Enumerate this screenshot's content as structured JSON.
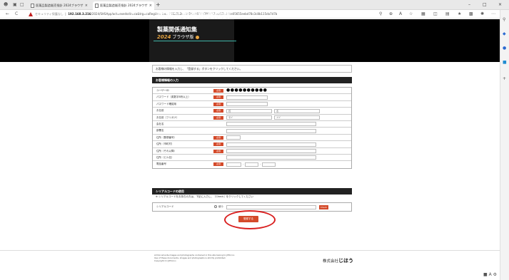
{
  "browser": {
    "tabs": [
      {
        "title": "医薬品製造販売指針 2024ブラウザ",
        "active": false
      },
      {
        "title": "医薬品製造販売指針 2024ブラウザ",
        "active": true
      }
    ],
    "new_tab": "+",
    "win_min": "–",
    "win_max": "□",
    "win_close": "×",
    "back": "←",
    "refresh": "C",
    "security_text": "セキュリティ保護なし",
    "url_host": "192.168.3.216",
    "url_path": "/2024/SHSApp/act=exedsdir=ca&trg=caRegUserdoc=74128b2883d555fb034c3ff0217?a017e2dce05655eebd78c3c8b115da7d7b",
    "icons": [
      "search-icon",
      "zoom-icon",
      "read-aloud-icon",
      "favorite-icon",
      "extension-icon",
      "split-icon",
      "collections-icon",
      "profile-icon",
      "more-icon"
    ]
  },
  "header": {
    "title": "医薬品製造販売指針",
    "subtitle": "製薬関係通知集",
    "year": "2024",
    "edition": "ブラウザ版"
  },
  "notice": "お客様の情報を入力し、「登録する」ボタンをクリックしてください。",
  "form": {
    "heading": "お客様情報の入力",
    "required_label": "必須",
    "rows": [
      {
        "label": "ユーザーID",
        "required": true,
        "value": "●●●●●●●●●●"
      },
      {
        "label": "パスワード（英数字8桁以上）",
        "required": true
      },
      {
        "label": "パスワード確認用",
        "required": true
      },
      {
        "label": "お名前",
        "required": true,
        "ph1": "姓",
        "ph2": "名"
      },
      {
        "label": "お名前（フリガナ）",
        "required": true,
        "ph1": "セイ",
        "ph2": "メイ"
      },
      {
        "label": "会社名",
        "required": false
      },
      {
        "label": "部署名",
        "required": false
      },
      {
        "label": "住所（郵便番号）",
        "required": true
      },
      {
        "label": "住所（市町村）",
        "required": true
      },
      {
        "label": "住所（それ以降）",
        "required": true
      },
      {
        "label": "住所（ビル名）",
        "required": false
      },
      {
        "label": "電話番号",
        "required": true
      }
    ]
  },
  "serial": {
    "heading": "シリアルコードの使用",
    "note": "※ シリアルコードをお持ちの方は、下記に入力し、［Check］をクリックしてください",
    "label": "シリアルコード",
    "radio_label": "使う",
    "check_label": "Check"
  },
  "submit_label": "登録する",
  "footer": {
    "copyright": "All Documents,images and photographs contained in this site belong to JIHO,Inc.\nUse of these documents, images and photographs is strictly prohibited.\nCopyright (C) JIHO,Inc.",
    "company_prefix": "株式会社",
    "company_name": "じほう"
  },
  "colors": {
    "accent": "#d44a2a",
    "banner": "#000000",
    "banner_line": "#3fb5a8",
    "year_accent": "#e9a642",
    "highlight": "#d92020"
  }
}
